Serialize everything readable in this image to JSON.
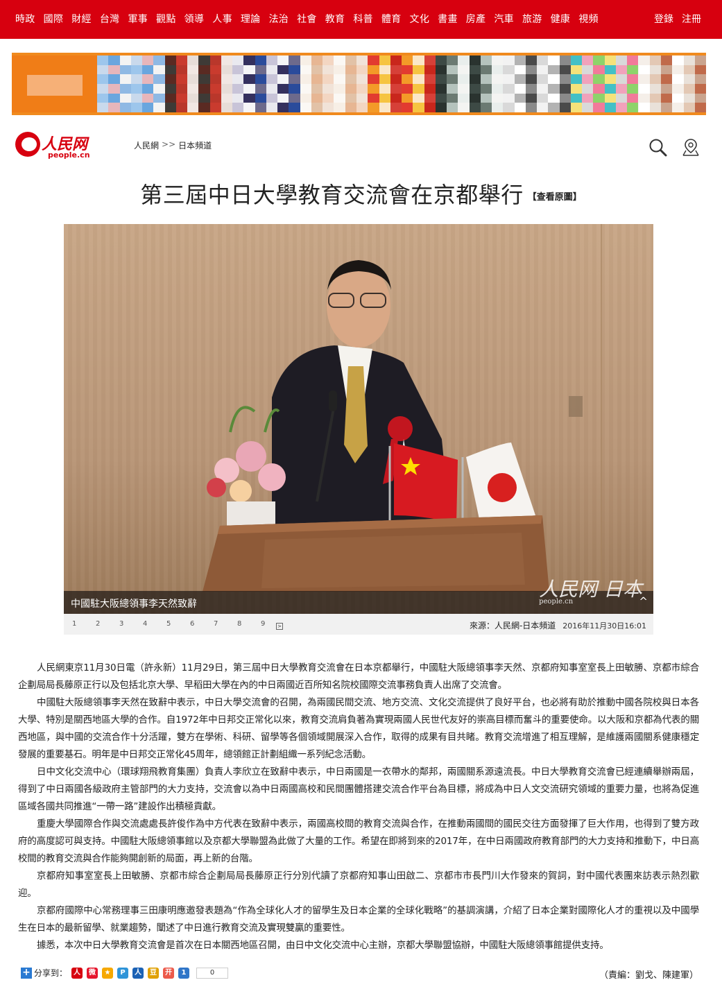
{
  "nav": {
    "items": [
      "時政",
      "國際",
      "財經",
      "台灣",
      "軍事",
      "觀點",
      "領導",
      "人事",
      "理論",
      "法治",
      "社會",
      "教育",
      "科普",
      "體育",
      "文化",
      "書畫",
      "房產",
      "汽車",
      "旅游",
      "健康",
      "視頻"
    ],
    "login": "登錄",
    "register": "注冊"
  },
  "logo": {
    "cn": "人民网",
    "en": "people.cn"
  },
  "breadcrumb": {
    "home": "人民網",
    "sep": ">>",
    "channel": "日本頻道"
  },
  "icons": {
    "search": "search-icon",
    "location": "location-pin-icon"
  },
  "article": {
    "title": "第三屆中日大學教育交流會在京都舉行",
    "view_original": "【查看原圖】",
    "photo_caption": "中國駐大阪總領事李天然致辭",
    "watermark": "人民网 日本",
    "watermark_sub": "people.cn",
    "pages": [
      "1",
      "2",
      "3",
      "4",
      "5",
      "6",
      "7",
      "8",
      "9"
    ],
    "source": "來源：人民網-日本頻道",
    "datetime": "2016年11月30日16:01",
    "paragraphs": [
      "人民網東京11月30日電（許永新）11月29日，第三屆中日大學教育交流會在日本京都舉行，中國駐大阪總領事李天然、京都府知事室室長上田敏勝、京都市綜合企劃局局長藤原正行以及包括北京大學、早稻田大學在內的中日兩國近百所知名院校國際交流事務負責人出席了交流會。",
      "中國駐大阪總領事李天然在致辭中表示，中日大學交流會的召開，為兩國民間交流、地方交流、文化交流提供了良好平台，也必將有助於推動中國各院校與日本各大學、特別是關西地區大學的合作。自1972年中日邦交正常化以來，教育交流肩負著為實現兩國人民世代友好的崇高目標而奮斗的重要使命。以大阪和京都為代表的關西地區，與中國的交流合作十分活躍，雙方在學術、科研、留學等各個領域開展深入合作，取得的成果有目共睹。教育交流增進了相互理解，是維護兩國關系健康穩定發展的重要基石。明年是中日邦交正常化45周年，總領館正計劃組織一系列紀念活動。",
      "日中文化交流中心（環球翔飛教育集團）負責人李欣立在致辭中表示，中日兩國是一衣帶水的鄰邦，兩國關系源遠流長。中日大學教育交流會已經連續舉辦兩屆，得到了中日兩國各級政府主管部門的大力支持，交流會以為中日兩國高校和民間團體搭建交流合作平台為目標，將成為中日人文交流研究領域的重要力量，也將為促進區域各國共同推進“一帶一路”建設作出積極貢獻。",
      "重慶大學國際合作與交流處處長許俊作為中方代表在致辭中表示，兩國高校間的教育交流與合作，在推動兩國間的國民交往方面發揮了巨大作用，也得到了雙方政府的高度認可與支持。中國駐大阪總領事館以及京都大學聯盟為此做了大量的工作。希望在即將到來的2017年，在中日兩國政府教育部門的大力支持和推動下，中日高校間的教育交流與合作能夠開創新的局面，再上新的台階。",
      "京都府知事室室長上田敏勝、京都市綜合企劃局局長藤原正行分別代讀了京都府知事山田啟二、京都市市長門川大作發來的賀詞，對中國代表團來訪表示熱烈歡迎。",
      "京都府國際中心常務理事三田康明應邀發表題為“作為全球化人才的留學生及日本企業的全球化戰略”的基調演講，介紹了日本企業對國際化人才的重視以及中國學生在日本的最新留學、就業趨勢，闡述了中日進行教育交流及實現雙贏的重要性。",
      "據悉，本次中日大學教育交流會是首次在日本關西地區召開，由日中文化交流中心主辦，京都大學聯盟協辦，中國駐大阪總領事館提供支持。"
    ],
    "share_label": "分享到：",
    "share_count": "0",
    "editor": "（責編：劉戈、陳建軍）"
  },
  "colors": {
    "brand_red": "#d7000f",
    "banner_orange": "#f08a1e"
  }
}
